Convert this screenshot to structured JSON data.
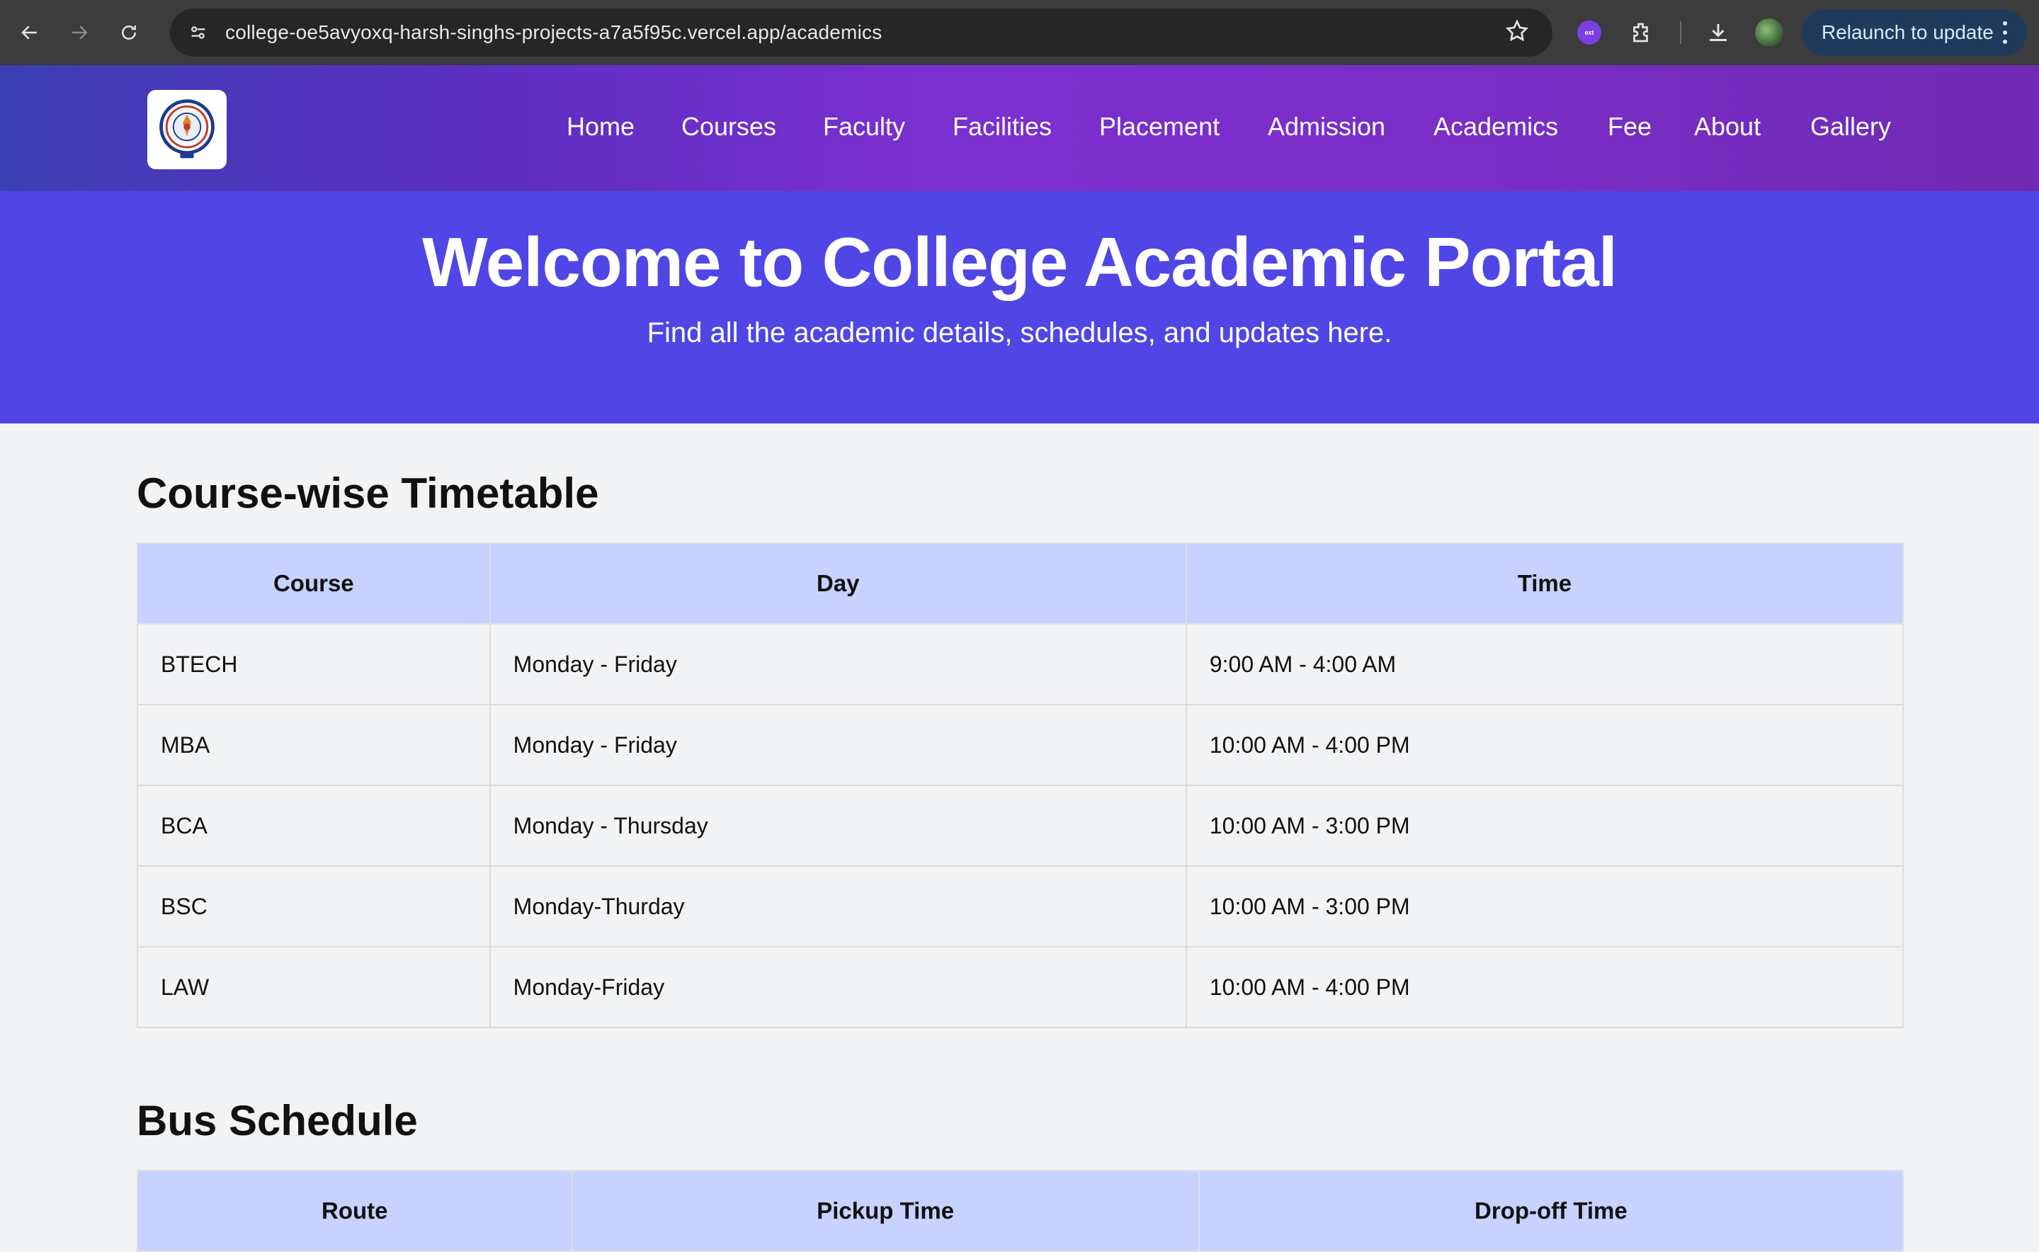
{
  "browser": {
    "url": "college-oe5avyoxq-harsh-singhs-projects-a7a5f95c.vercel.app/academics",
    "relaunch_label": "Relaunch to update",
    "extension_badge": "ext"
  },
  "header": {
    "nav": [
      "Home",
      "Courses",
      "Faculty",
      "Facilities",
      "Placement",
      "Admission",
      "Academics",
      "Fee",
      "About",
      "Gallery"
    ]
  },
  "hero": {
    "title": "Welcome to College Academic Portal",
    "subtitle": "Find all the academic details, schedules, and updates here."
  },
  "timetable": {
    "title": "Course-wise Timetable",
    "headers": [
      "Course",
      "Day",
      "Time"
    ],
    "rows": [
      [
        "BTECH",
        "Monday - Friday",
        "9:00 AM - 4:00 AM"
      ],
      [
        "MBA",
        "Monday - Friday",
        "10:00 AM - 4:00 PM"
      ],
      [
        "BCA",
        "Monday - Thursday",
        "10:00 AM - 3:00 PM"
      ],
      [
        "BSC",
        "Monday-Thurday",
        "10:00 AM - 3:00 PM"
      ],
      [
        "LAW",
        "Monday-Friday",
        "10:00 AM - 4:00 PM"
      ]
    ]
  },
  "bus": {
    "title": "Bus Schedule",
    "headers": [
      "Route",
      "Pickup Time",
      "Drop-off Time"
    ]
  },
  "colors": {
    "hero_bg": "#4f46e5",
    "table_header_bg": "#c7d2fe",
    "page_bg": "#f2f3f5"
  }
}
